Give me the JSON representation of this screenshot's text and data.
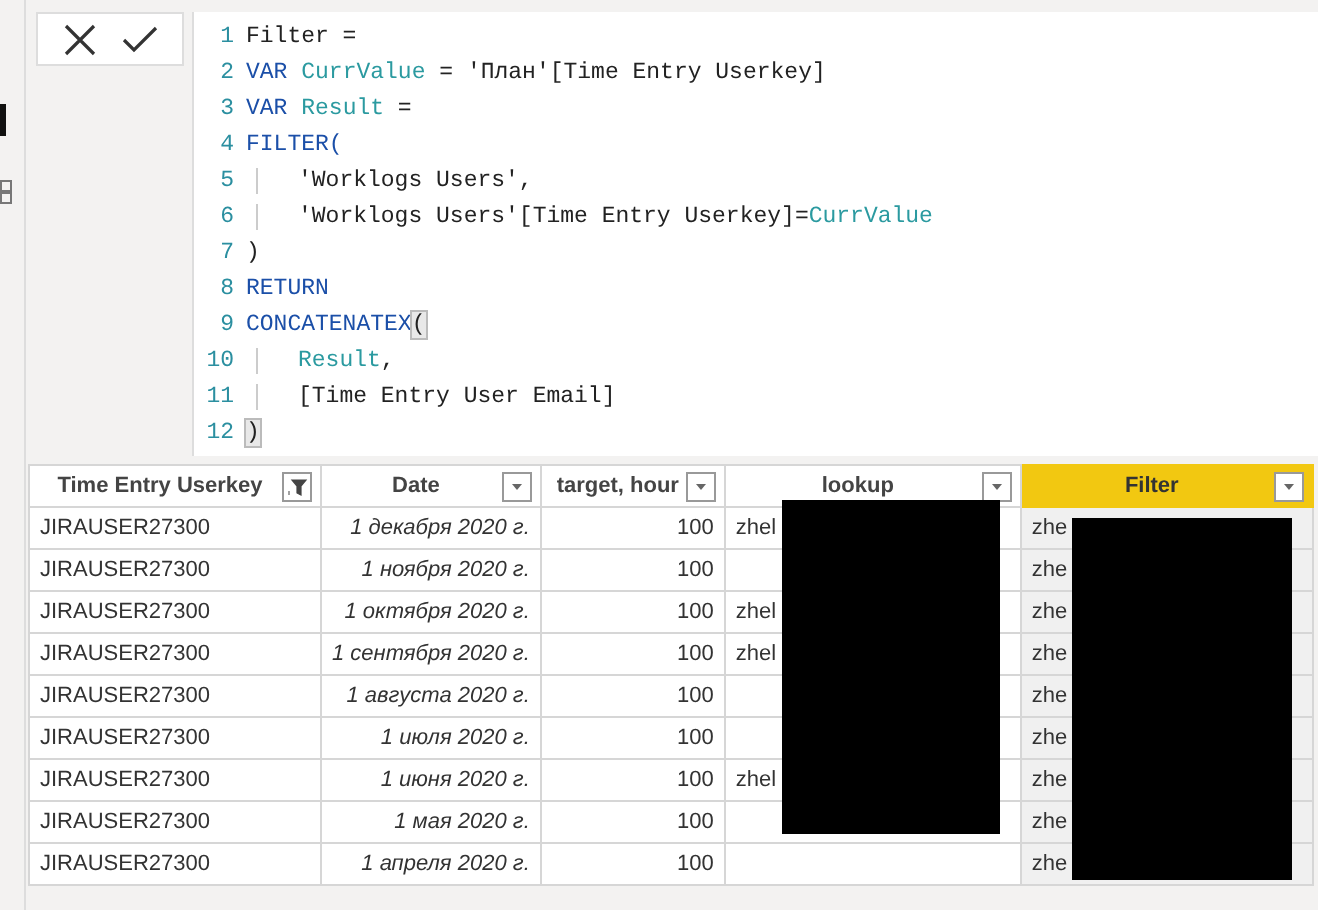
{
  "formula_bar": {
    "lines": [
      {
        "number": "1",
        "indent": false,
        "tokens": [
          {
            "text": "Filter =",
            "kind": "plain"
          }
        ]
      },
      {
        "number": "2",
        "indent": false,
        "tokens": [
          {
            "text": "VAR ",
            "kind": "keyword"
          },
          {
            "text": "CurrValue",
            "kind": "variable"
          },
          {
            "text": " = 'План'[Time Entry Userkey]",
            "kind": "plain"
          }
        ]
      },
      {
        "number": "3",
        "indent": false,
        "tokens": [
          {
            "text": "VAR ",
            "kind": "keyword"
          },
          {
            "text": "Result",
            "kind": "variable"
          },
          {
            "text": " =",
            "kind": "plain"
          }
        ]
      },
      {
        "number": "4",
        "indent": false,
        "tokens": [
          {
            "text": "FILTER(",
            "kind": "keyword"
          }
        ]
      },
      {
        "number": "5",
        "indent": true,
        "tokens": [
          {
            "text": "'Worklogs Users',",
            "kind": "plain"
          }
        ]
      },
      {
        "number": "6",
        "indent": true,
        "tokens": [
          {
            "text": "'Worklogs Users'[Time Entry Userkey]=",
            "kind": "plain"
          },
          {
            "text": "CurrValue",
            "kind": "variable"
          }
        ]
      },
      {
        "number": "7",
        "indent": false,
        "tokens": [
          {
            "text": ")",
            "kind": "plain"
          }
        ]
      },
      {
        "number": "8",
        "indent": false,
        "tokens": [
          {
            "text": "RETURN",
            "kind": "keyword"
          }
        ]
      },
      {
        "number": "9",
        "indent": false,
        "tokens": [
          {
            "text": "CONCATENATEX",
            "kind": "keyword"
          },
          {
            "text": "(",
            "kind": "bracket"
          }
        ]
      },
      {
        "number": "10",
        "indent": true,
        "tokens": [
          {
            "text": "Result",
            "kind": "variable"
          },
          {
            "text": ",",
            "kind": "plain"
          }
        ]
      },
      {
        "number": "11",
        "indent": true,
        "tokens": [
          {
            "text": "[Time Entry User Email]",
            "kind": "plain"
          }
        ]
      },
      {
        "number": "12",
        "indent": false,
        "tokens": [
          {
            "text": ")",
            "kind": "bracket"
          }
        ]
      }
    ]
  },
  "table": {
    "columns": [
      {
        "label": "Time Entry Userkey",
        "filtered": true,
        "selected": false,
        "kind": "text"
      },
      {
        "label": "Date",
        "filtered": false,
        "selected": false,
        "kind": "date"
      },
      {
        "label": "target, hour",
        "filtered": false,
        "selected": false,
        "kind": "number"
      },
      {
        "label": "lookup",
        "filtered": false,
        "selected": false,
        "kind": "text"
      },
      {
        "label": "Filter",
        "filtered": false,
        "selected": true,
        "kind": "text"
      }
    ],
    "rows": [
      {
        "cells": [
          "JIRAUSER27300",
          "1 декабря 2020 г.",
          "100",
          "zhel",
          "zhe"
        ]
      },
      {
        "cells": [
          "JIRAUSER27300",
          "1 ноября 2020 г.",
          "100",
          "",
          "zhe"
        ]
      },
      {
        "cells": [
          "JIRAUSER27300",
          "1 октября 2020 г.",
          "100",
          "zhel",
          "zhe"
        ]
      },
      {
        "cells": [
          "JIRAUSER27300",
          "1 сентября 2020 г.",
          "100",
          "zhel",
          "zhe"
        ]
      },
      {
        "cells": [
          "JIRAUSER27300",
          "1 августа 2020 г.",
          "100",
          "",
          "zhe"
        ]
      },
      {
        "cells": [
          "JIRAUSER27300",
          "1 июля 2020 г.",
          "100",
          "",
          "zhe"
        ]
      },
      {
        "cells": [
          "JIRAUSER27300",
          "1 июня 2020 г.",
          "100",
          "zhel",
          "zhe"
        ]
      },
      {
        "cells": [
          "JIRAUSER27300",
          "1 мая 2020 г.",
          "100",
          "",
          "zhe"
        ]
      },
      {
        "cells": [
          "JIRAUSER27300",
          "1 апреля 2020 г.",
          "100",
          "",
          "zhe"
        ]
      }
    ]
  }
}
